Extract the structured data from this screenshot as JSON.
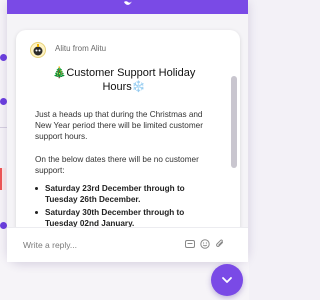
{
  "message": {
    "author": "Alitu from Alitu",
    "title_emoji_start": "🎄",
    "title": "Customer Support Holiday Hours",
    "title_emoji_end": "❄️",
    "paragraph_1": "Just a heads up that during the Christmas and New Year period there will be limited customer support hours.",
    "paragraph_2": "On the below dates there will be no customer support:",
    "dates": [
      "Saturday 23rd December through to Tuesday 26th December.",
      "Saturday 30th December through to Tuesday 02nd January."
    ]
  },
  "composer": {
    "placeholder": "Write a reply..."
  },
  "icons": {
    "header": "bird-icon",
    "gif": "gif-icon",
    "emoji": "emoji-icon",
    "attach": "paperclip-icon",
    "launcher": "chevron-down-icon"
  },
  "colors": {
    "accent": "#7a4ae6",
    "card_bg": "#ffffff",
    "panel_bg": "#f5f4f7"
  }
}
